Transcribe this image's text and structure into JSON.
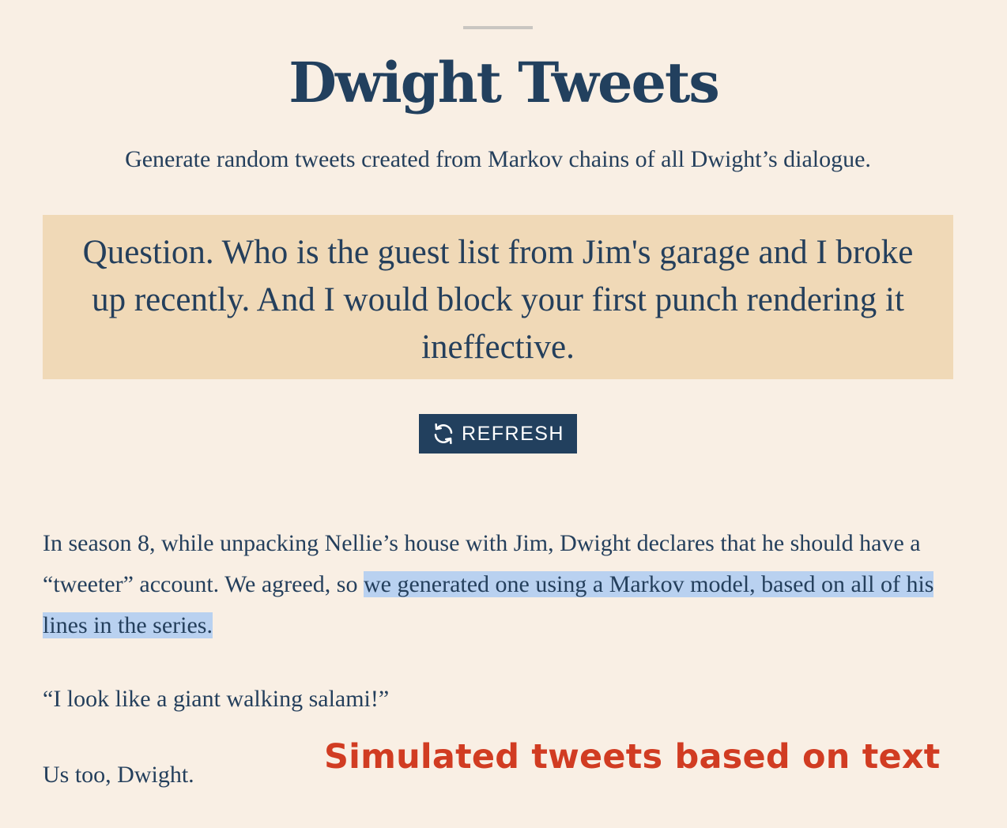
{
  "header": {
    "title": "Dwight Tweets",
    "subtitle": "Generate random tweets created from Markov chains of all Dwight’s dialogue."
  },
  "tweet": {
    "text": "Question. Who is the guest list from Jim's garage and I broke up recently. And I would block your first punch rendering it ineffective."
  },
  "refresh_button": {
    "icon": "refresh-icon",
    "label": "REFRESH"
  },
  "article": {
    "intro_plain": "In season 8, while unpacking Nellie’s house with Jim, Dwight declares that he should have a “tweeter” account. We agreed, so ",
    "intro_highlighted": "we generated one using a Markov model, based on all of his lines in the series.",
    "quote": "“I look like a giant walking salami!”",
    "closing": "Us too, Dwight."
  },
  "annotation": {
    "text": "Simulated tweets based on text"
  },
  "colors": {
    "background": "#f9efe4",
    "navy": "#22405e",
    "tweet_background": "#f0d9b7",
    "highlight": "#b9d1f0",
    "annotation": "#d13c22"
  }
}
